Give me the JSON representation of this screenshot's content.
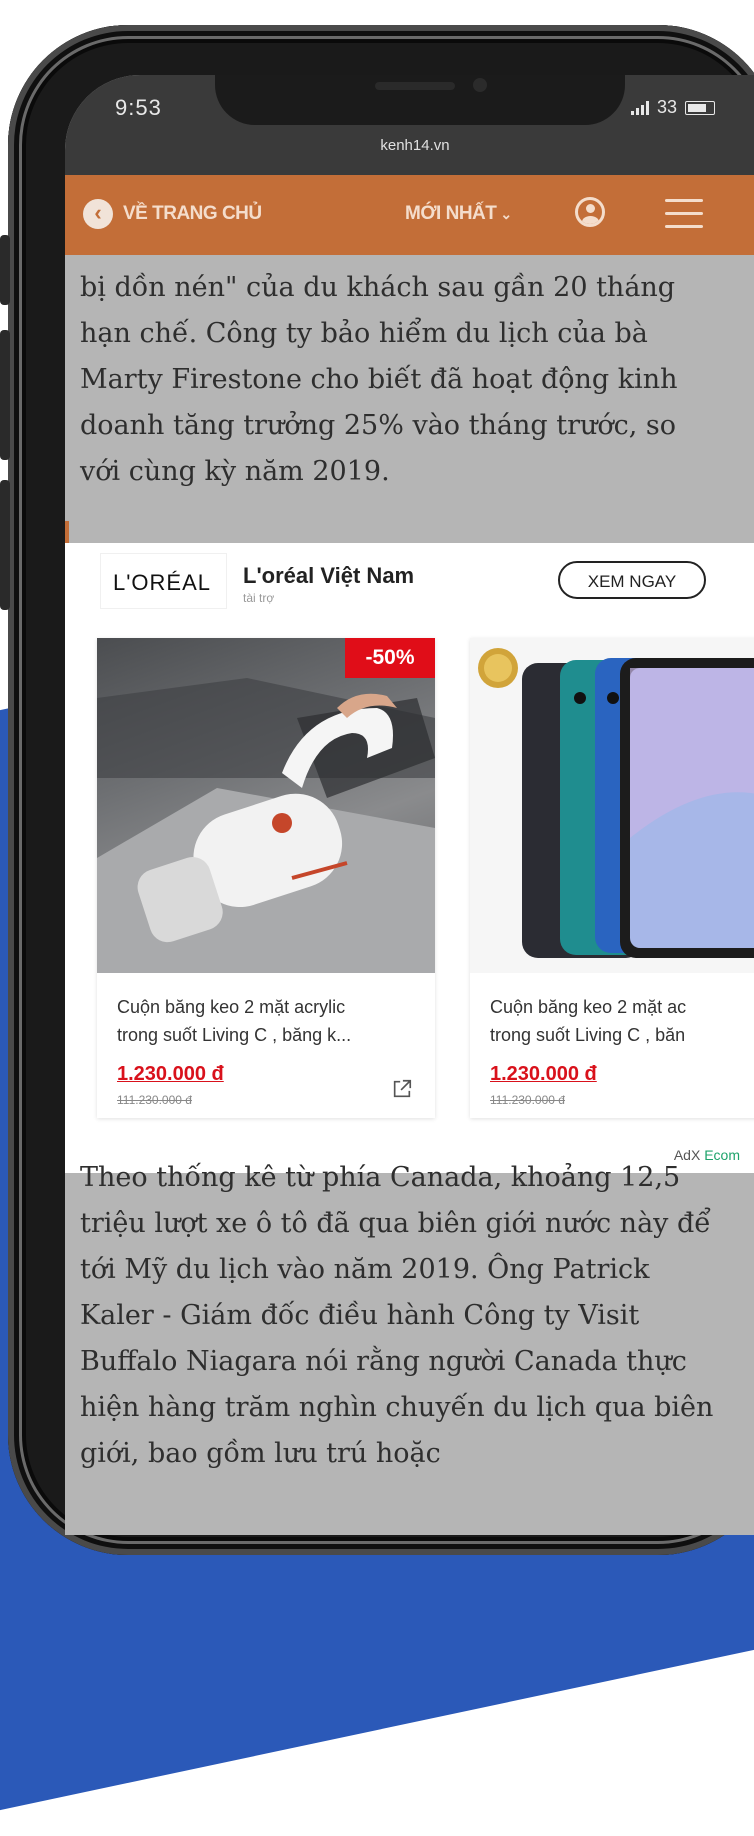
{
  "status_bar": {
    "time": "9:53",
    "battery_level": "33",
    "url": "kenh14.vn"
  },
  "nav": {
    "home_label": "VỀ TRANG CHỦ",
    "latest_label": "MỚI NHẤT",
    "latest_chevron": "⌄"
  },
  "article": {
    "paragraph_1": "bị dồn nén\" của du khách sau gần 20 tháng hạn chế. Công ty bảo hiểm du lịch của bà Marty Firestone cho biết đã hoạt động kinh doanh tăng trưởng 25% vào tháng trước, so với cùng kỳ năm 2019.",
    "paragraph_2": "Theo thống kê từ phía Canada, khoảng 12,5 triệu lượt xe ô tô đã qua biên giới nước này để tới Mỹ du lịch vào năm 2019. Ông Patrick Kaler - Giám đốc điều hành Công ty Visit Buffalo Niagara nói rằng người Canada thực hiện hàng trăm nghìn chuyến du lịch qua biên giới, bao gồm lưu trú hoặc"
  },
  "ad": {
    "logo_text": "L'ORÉAL",
    "brand_name": "L'oréal Việt Nam",
    "sponsored": "tài trợ",
    "cta": "XEM NGAY",
    "products": [
      {
        "discount": "-50%",
        "title_line1": "Cuộn băng keo 2 mặt acrylic",
        "title_line2": "trong suốt Living C , băng k...",
        "price": "1.230.000 đ",
        "old_price": "111.230.000 đ"
      },
      {
        "title_line1": "Cuộn băng keo 2 mặt ac",
        "title_line2": "trong suốt Living C , băn",
        "price": "1.230.000 đ",
        "old_price": "111.230.000 đ"
      }
    ],
    "network_prefix": "AdX",
    "network_suffix": "Ecom"
  },
  "colors": {
    "nav_bg": "#c36e38",
    "price_red": "#d9111b",
    "ecom_green": "#1ea36b",
    "backdrop_blue": "#2b59b8"
  }
}
